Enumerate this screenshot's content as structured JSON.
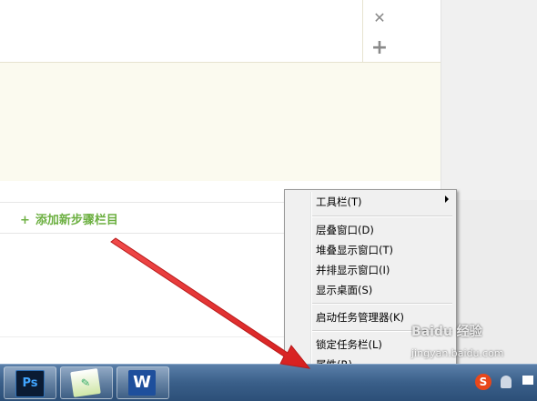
{
  "editor": {
    "close_glyph": "✕",
    "add_glyph": "+",
    "add_step_plus": "+",
    "add_step_label": "添加新步骤栏目"
  },
  "context_menu": {
    "items": [
      {
        "label": "工具栏(T)",
        "submenu": true
      },
      {
        "label": "层叠窗口(D)"
      },
      {
        "label": "堆叠显示窗口(T)"
      },
      {
        "label": "并排显示窗口(I)"
      },
      {
        "label": "显示桌面(S)"
      },
      {
        "label": "启动任务管理器(K)"
      },
      {
        "label": "锁定任务栏(L)"
      },
      {
        "label": "属性(R)"
      }
    ]
  },
  "taskbar": {
    "apps": [
      {
        "name": "photoshop-app",
        "label": "Ps"
      },
      {
        "name": "notepad-app",
        "label": "✎"
      },
      {
        "name": "wps-app",
        "label": "W"
      }
    ],
    "tray_ime_label": "S"
  },
  "watermark": {
    "logo": "Baidu 经验",
    "url": "jingyan.baidu.com"
  },
  "colors": {
    "accent_green": "#6db042",
    "arrow_red": "#e03030",
    "taskbar_blue": "#3a5f89"
  }
}
